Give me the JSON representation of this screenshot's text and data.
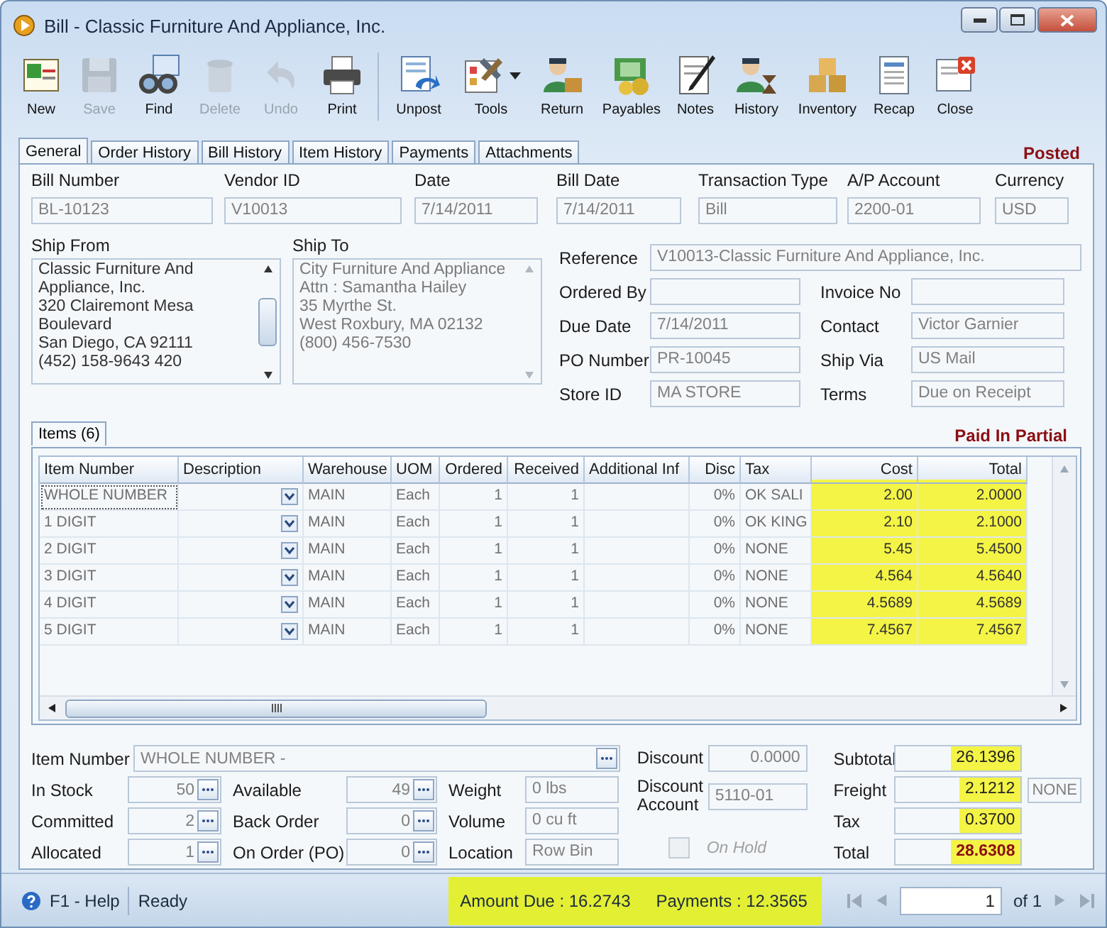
{
  "window": {
    "title": "Bill - Classic Furniture And Appliance, Inc."
  },
  "toolbar": [
    {
      "label": "New",
      "disabled": false,
      "dropdown": false
    },
    {
      "label": "Save",
      "disabled": true,
      "dropdown": false
    },
    {
      "label": "Find",
      "disabled": false,
      "dropdown": false
    },
    {
      "label": "Delete",
      "disabled": true,
      "dropdown": false
    },
    {
      "label": "Undo",
      "disabled": true,
      "dropdown": false
    },
    {
      "label": "Print",
      "disabled": false,
      "dropdown": false
    },
    {
      "label": "Unpost",
      "disabled": false,
      "dropdown": false
    },
    {
      "label": "Tools",
      "disabled": false,
      "dropdown": true
    },
    {
      "label": "Return",
      "disabled": false,
      "dropdown": false
    },
    {
      "label": "Payables",
      "disabled": false,
      "dropdown": false
    },
    {
      "label": "Notes",
      "disabled": false,
      "dropdown": false
    },
    {
      "label": "History",
      "disabled": false,
      "dropdown": false
    },
    {
      "label": "Inventory",
      "disabled": false,
      "dropdown": false
    },
    {
      "label": "Recap",
      "disabled": false,
      "dropdown": false
    },
    {
      "label": "Close",
      "disabled": false,
      "dropdown": false
    }
  ],
  "tabs": [
    {
      "label": "General",
      "selected": true
    },
    {
      "label": "Order History",
      "selected": false
    },
    {
      "label": "Bill History",
      "selected": false
    },
    {
      "label": "Item History",
      "selected": false
    },
    {
      "label": "Payments",
      "selected": false
    },
    {
      "label": "Attachments",
      "selected": false
    }
  ],
  "status_badge": "Posted",
  "header_fields": [
    {
      "label": "Bill Number",
      "value": "BL-10123"
    },
    {
      "label": "Vendor ID",
      "value": "V10013"
    },
    {
      "label": "Date",
      "value": "7/14/2011"
    },
    {
      "label": "Bill Date",
      "value": "7/14/2011"
    },
    {
      "label": "Transaction Type",
      "value": "Bill"
    },
    {
      "label": "A/P Account",
      "value": "2200-01"
    },
    {
      "label": "Currency",
      "value": "USD"
    }
  ],
  "ship_from": {
    "label": "Ship From",
    "lines": [
      "Classic Furniture And",
      "Appliance, Inc.",
      "320 Clairemont Mesa",
      "Boulevard",
      "San Diego, CA 92111",
      "(452) 158-9643 420"
    ]
  },
  "ship_to": {
    "label": "Ship To",
    "lines": [
      "City Furniture And Appliance",
      "Attn : Samantha Hailey",
      "35 Myrthe St.",
      "West Roxbury, MA 02132",
      "(800) 456-7530"
    ]
  },
  "reference": {
    "label": "Reference",
    "value": "V10013-Classic Furniture And Appliance, Inc."
  },
  "details": [
    {
      "label": "Ordered By"
    },
    {
      "label": "Invoice No"
    },
    {
      "label": "Due Date",
      "value": "7/14/2011"
    },
    {
      "label": "Contact",
      "value": "Victor Garnier"
    },
    {
      "label": "PO Number",
      "value": "PR-10045"
    },
    {
      "label": "Ship Via",
      "value": "US Mail"
    },
    {
      "label": "Store ID",
      "value": "MA STORE"
    },
    {
      "label": "Terms",
      "value": "Due on Receipt"
    }
  ],
  "items_tab": {
    "label": "Items (6)",
    "selected": true
  },
  "payment_status": "Paid In Partial",
  "grid": {
    "columns": [
      {
        "label": "Item Number",
        "kind": "text",
        "highlighted": false
      },
      {
        "label": "Description",
        "kind": "dropdown",
        "highlighted": false
      },
      {
        "label": "Warehouse",
        "kind": "text",
        "highlighted": false
      },
      {
        "label": "UOM",
        "kind": "text",
        "highlighted": false
      },
      {
        "label": "Ordered",
        "kind": "number",
        "highlighted": false
      },
      {
        "label": "Received",
        "kind": "number",
        "highlighted": false
      },
      {
        "label": "Additional Inf",
        "kind": "text",
        "highlighted": false
      },
      {
        "label": "Disc",
        "kind": "number",
        "highlighted": false
      },
      {
        "label": "Tax",
        "kind": "text",
        "highlighted": false
      },
      {
        "label": "Cost",
        "kind": "number",
        "highlighted": true
      },
      {
        "label": "Total",
        "kind": "number",
        "highlighted": true
      }
    ],
    "rows": [
      {
        "focused": true,
        "cells": [
          "WHOLE NUMBER",
          "",
          "MAIN",
          "Each",
          "1",
          "1",
          "",
          "0%",
          "OK SALI",
          "2.00",
          "2.0000"
        ]
      },
      {
        "focused": false,
        "cells": [
          "1 DIGIT",
          "",
          "MAIN",
          "Each",
          "1",
          "1",
          "",
          "0%",
          "OK KING",
          "2.10",
          "2.1000"
        ]
      },
      {
        "focused": false,
        "cells": [
          "2 DIGIT",
          "",
          "MAIN",
          "Each",
          "1",
          "1",
          "",
          "0%",
          "NONE",
          "5.45",
          "5.4500"
        ]
      },
      {
        "focused": false,
        "cells": [
          "3 DIGIT",
          "",
          "MAIN",
          "Each",
          "1",
          "1",
          "",
          "0%",
          "NONE",
          "4.564",
          "4.5640"
        ]
      },
      {
        "focused": false,
        "cells": [
          "4 DIGIT",
          "",
          "MAIN",
          "Each",
          "1",
          "1",
          "",
          "0%",
          "NONE",
          "4.5689",
          "4.5689"
        ]
      },
      {
        "focused": false,
        "cells": [
          "5 DIGIT",
          "",
          "MAIN",
          "Each",
          "1",
          "1",
          "",
          "0%",
          "NONE",
          "7.4567",
          "7.4567"
        ]
      }
    ]
  },
  "item_number": {
    "label": "Item Number",
    "value": "WHOLE NUMBER -"
  },
  "stock": [
    {
      "label": "In Stock",
      "value": "50"
    },
    {
      "label": "Available",
      "value": "49"
    },
    {
      "label": "Committed",
      "value": "2"
    },
    {
      "label": "Back Order",
      "value": "0"
    },
    {
      "label": "Allocated",
      "value": "1"
    },
    {
      "label": "On Order (PO)",
      "value": "0"
    }
  ],
  "measures": [
    {
      "label": "Weight",
      "value": "0 lbs"
    },
    {
      "label": "Volume",
      "value": "0 cu ft"
    },
    {
      "label": "Location",
      "value": "Row  Bin"
    }
  ],
  "discount": {
    "label": "Discount",
    "value": "0.0000"
  },
  "discount_account": {
    "label": "Discount Account",
    "value": "5110-01"
  },
  "on_hold": {
    "label": "On Hold",
    "checked": false,
    "disabled": true
  },
  "totals": [
    {
      "label": "Subtotal",
      "value": "26.1396",
      "highlighted": true,
      "emphasis": false
    },
    {
      "label": "Freight",
      "value": "2.1212",
      "highlighted": true,
      "emphasis": false,
      "tag": "NONE"
    },
    {
      "label": "Tax",
      "value": "0.3700",
      "highlighted": true,
      "emphasis": false
    },
    {
      "label": "Total",
      "value": "28.6308",
      "highlighted": true,
      "emphasis": true
    }
  ],
  "status_bar": {
    "help": "F1 - Help",
    "status": "Ready",
    "amount_due": "Amount Due : 16.2743",
    "payments": "Payments : 12.3565",
    "highlighted": true,
    "page": "1",
    "page_total": "of 1"
  }
}
